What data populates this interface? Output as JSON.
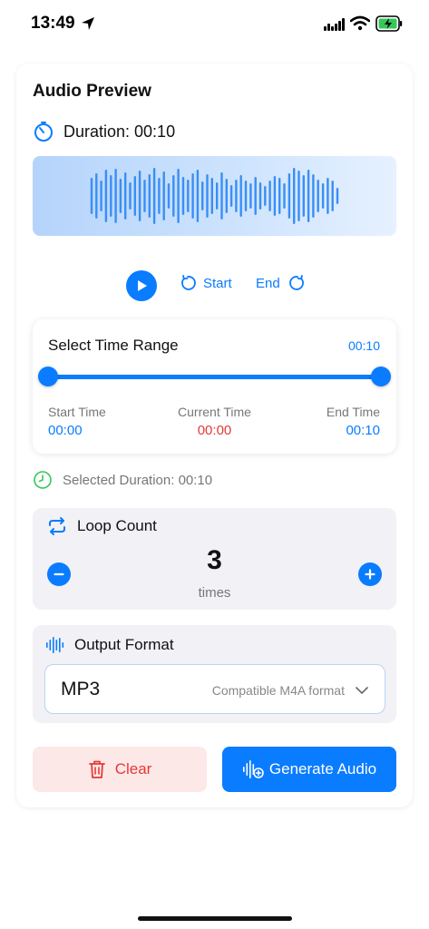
{
  "status_bar": {
    "time": "13:49"
  },
  "audio_preview": {
    "title": "Audio Preview",
    "duration_label": "Duration: 00:10"
  },
  "controls": {
    "start_label": "Start",
    "end_label": "End"
  },
  "time_range": {
    "title": "Select Time Range",
    "selected_value": "00:10",
    "start_time_label": "Start Time",
    "start_time_value": "00:00",
    "current_time_label": "Current Time",
    "current_time_value": "00:00",
    "end_time_label": "End Time",
    "end_time_value": "00:10",
    "range_start_fraction": 0.0,
    "range_end_fraction": 1.0
  },
  "selected_duration": "Selected Duration: 00:10",
  "loop": {
    "title": "Loop Count",
    "count": "3",
    "unit": "times"
  },
  "output_format": {
    "title": "Output Format",
    "selected": "MP3",
    "description": "Compatible M4A format"
  },
  "actions": {
    "clear_label": "Clear",
    "generate_label": "Generate Audio"
  },
  "colors": {
    "accent": "#0a7cff",
    "danger": "#e53935",
    "success": "#34c759"
  },
  "icons": {
    "location": "location-arrow-icon",
    "duration": "timer-icon",
    "selected_duration": "clock-icon",
    "loop": "repeat-icon",
    "format": "waveform-icon",
    "clear": "trash-icon",
    "generate": "waveform-plus-icon"
  }
}
